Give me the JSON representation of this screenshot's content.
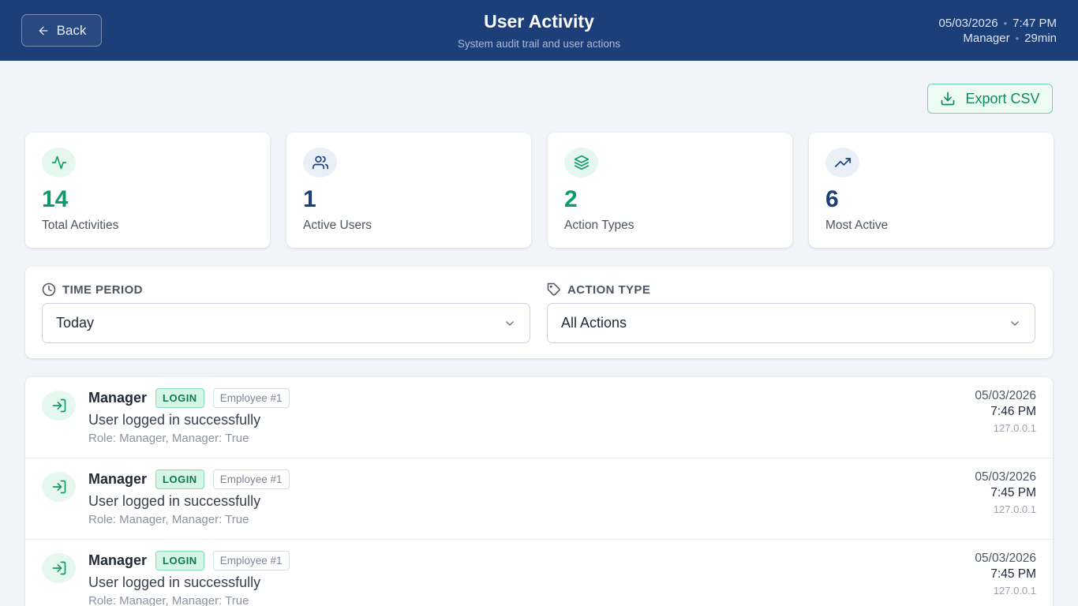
{
  "header": {
    "back_label": "Back",
    "title": "User Activity",
    "subtitle": "System audit trail and user actions",
    "date": "05/03/2026",
    "time": "7:47 PM",
    "user": "Manager",
    "session": "29min",
    "bg_color": "#1c3f7a"
  },
  "toolbar": {
    "export_label": "Export CSV",
    "accent_color": "#0f9a6b"
  },
  "stats": [
    {
      "value": "14",
      "label": "Total Activities",
      "icon": "activity-icon"
    },
    {
      "value": "1",
      "label": "Active Users",
      "icon": "users-icon"
    },
    {
      "value": "2",
      "label": "Action Types",
      "icon": "layers-icon"
    },
    {
      "value": "6",
      "label": "Most Active",
      "icon": "trending-up-icon"
    }
  ],
  "filters": {
    "time_period": {
      "label": "TIME PERIOD",
      "value": "Today"
    },
    "action_type": {
      "label": "ACTION TYPE",
      "value": "All Actions"
    }
  },
  "activities": [
    {
      "user": "Manager",
      "action": "LOGIN",
      "employee": "Employee #1",
      "description": "User logged in successfully",
      "meta": "Role: Manager, Manager: True",
      "date": "05/03/2026",
      "time": "7:46 PM",
      "ip": "127.0.0.1"
    },
    {
      "user": "Manager",
      "action": "LOGIN",
      "employee": "Employee #1",
      "description": "User logged in successfully",
      "meta": "Role: Manager, Manager: True",
      "date": "05/03/2026",
      "time": "7:45 PM",
      "ip": "127.0.0.1"
    },
    {
      "user": "Manager",
      "action": "LOGIN",
      "employee": "Employee #1",
      "description": "User logged in successfully",
      "meta": "Role: Manager, Manager: True",
      "date": "05/03/2026",
      "time": "7:45 PM",
      "ip": "127.0.0.1"
    }
  ]
}
